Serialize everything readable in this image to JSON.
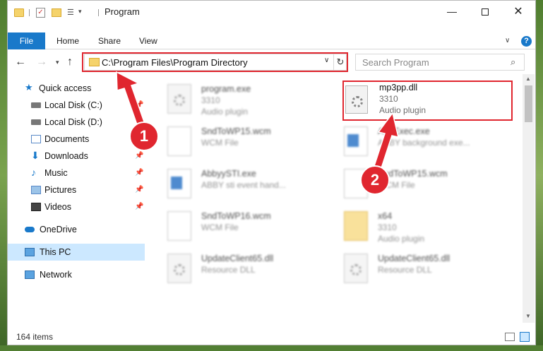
{
  "window": {
    "title": "Program"
  },
  "ribbon": {
    "file": "File",
    "home": "Home",
    "share": "Share",
    "view": "View"
  },
  "address": {
    "path": "C:\\Program Files\\Program Directory"
  },
  "search": {
    "placeholder": "Search Program"
  },
  "nav_items": [
    {
      "label": "Quick access",
      "icon": "star-icon"
    },
    {
      "label": "Local Disk (C:)",
      "icon": "drive-icon",
      "pinned": true
    },
    {
      "label": "Local Disk (D:)",
      "icon": "drive-icon",
      "pinned": true
    },
    {
      "label": "Documents",
      "icon": "documents-icon",
      "pinned": true
    },
    {
      "label": "Downloads",
      "icon": "download-icon",
      "pinned": true
    },
    {
      "label": "Music",
      "icon": "music-icon",
      "pinned": true
    },
    {
      "label": "Pictures",
      "icon": "pictures-icon",
      "pinned": true
    },
    {
      "label": "Videos",
      "icon": "videos-icon",
      "pinned": true
    },
    {
      "label": "OneDrive",
      "icon": "cloud-icon"
    },
    {
      "label": "This PC",
      "icon": "computer-icon",
      "selected": true
    },
    {
      "label": "Network",
      "icon": "network-icon"
    }
  ],
  "files": [
    {
      "name": "program.exe",
      "line1": "3310",
      "line2": "Audio plugin"
    },
    {
      "name": "mp3pp.dll",
      "line1": "3310",
      "line2": "Audio plugin"
    },
    {
      "name": "SndToWP15.wcm",
      "line1": "WCM File",
      "line2": ""
    },
    {
      "name": "AudExec.exe",
      "line1": "ABBY background exe...",
      "line2": ""
    },
    {
      "name": "AbbyySTI.exe",
      "line1": "ABBY sti event hand...",
      "line2": ""
    },
    {
      "name": "SndToWP15.wcm",
      "line1": "WCM File",
      "line2": ""
    },
    {
      "name": "SndToWP16.wcm",
      "line1": "WCM File",
      "line2": ""
    },
    {
      "name": "x64",
      "line1": "3310",
      "line2": "Audio plugin"
    },
    {
      "name": "UpdateClient65.dll",
      "line1": "Resource DLL",
      "line2": ""
    },
    {
      "name": "UpdateClient65.dll",
      "line1": "Resource DLL",
      "line2": ""
    }
  ],
  "status": {
    "count": "164 items"
  },
  "annotations": {
    "badge1": "1",
    "badge2": "2",
    "color": "#e0262f"
  }
}
